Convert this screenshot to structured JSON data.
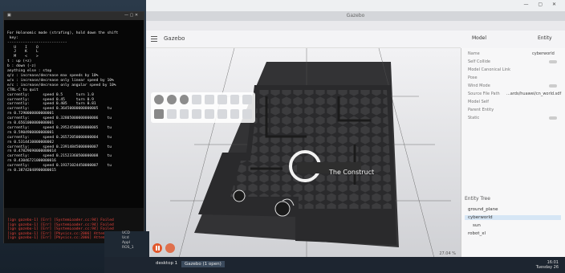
{
  "gazebo": {
    "window_title": "Gazebo",
    "app_name": "Gazebo",
    "zoom": "27.04 %",
    "scene_logo": "The Construct"
  },
  "panel": {
    "tab_model": "Model",
    "tab_entity": "Entity",
    "rows": [
      {
        "label": "Name",
        "value": "cyberworld"
      },
      {
        "label": "Self Collide",
        "value": ""
      },
      {
        "label": "Model Canonical Link",
        "value": ""
      },
      {
        "label": "Pose",
        "value": ""
      },
      {
        "label": "Wind Mode",
        "value": ""
      },
      {
        "label": "Source File Path",
        "value": "...ards/huawei/cn_world.sdf"
      },
      {
        "label": "Model Self",
        "value": ""
      },
      {
        "label": "Parent Entity",
        "value": ""
      },
      {
        "label": "Static",
        "value": ""
      }
    ],
    "tree_title": "Entity Tree",
    "tree": [
      "ground_plane",
      "cyberworld",
      "sun",
      "robot_xl"
    ]
  },
  "terminal": {
    "lines": [
      "For Holonomic mode (strafing), hold down the shift",
      " key:",
      "---------------------------",
      "   U    I    O",
      "   J    K    L",
      "   M    <    >",
      "",
      "t : up (+z)",
      "b : down (-z)",
      "",
      "anything else : stop",
      "",
      "q/z : increase/decrease max speeds by 10%",
      "w/x : increase/decrease only linear speed by 10%",
      "e/c : increase/decrease only angular speed by 10%",
      "",
      "CTRL-C to quit",
      "",
      "currently:      speed 0.5      turn 1.0",
      "currently:      speed 0.45     turn 0.9",
      "currently:      speed 0.405    turn 0.81",
      "currently:      speed 0.36450000000000005    tu",
      "rn 0.7290000000000001",
      "currently:      speed 0.32805000000000006    tu",
      "rn 0.6561000000000001",
      "currently:      speed 0.29524500000000005    tu",
      "rn 0.5904900000000001",
      "currently:      speed 0.26572050000000004    tu",
      "rn 0.5314410000000002",
      "currently:      speed 0.23914845000000007    tu",
      "rn 0.47829690000000014",
      "currently:      speed 0.21523360500000008    tu",
      "rn 0.43046721000000016",
      "currently:      speed 0.19371024450000007    tu",
      "rn 0.38742048900000015"
    ],
    "bottom_lines": [
      "[ign gazebo-1] [Err] [SystemLoader.cc:94] Failed",
      "[ign gazebo-1] [Err] [SystemLoader.cc:94] Failed",
      "[ign gazebo-1] [Err] [SystemLoader.cc:94] Failed",
      "[ign gazebo-1] [Err] [Physics.cc:2006] Attempt",
      "[ign gazebo-1] [Err] [Physics.cc:2006] Attempt"
    ]
  },
  "taskbar": {
    "items": [
      "desktop 1",
      "Gazebo (1 open)"
    ],
    "dock": [
      "UCD",
      "Ucd",
      "Appl",
      "ROS_1"
    ],
    "clock_time": "16:01",
    "clock_date": "Tuesday 26"
  }
}
